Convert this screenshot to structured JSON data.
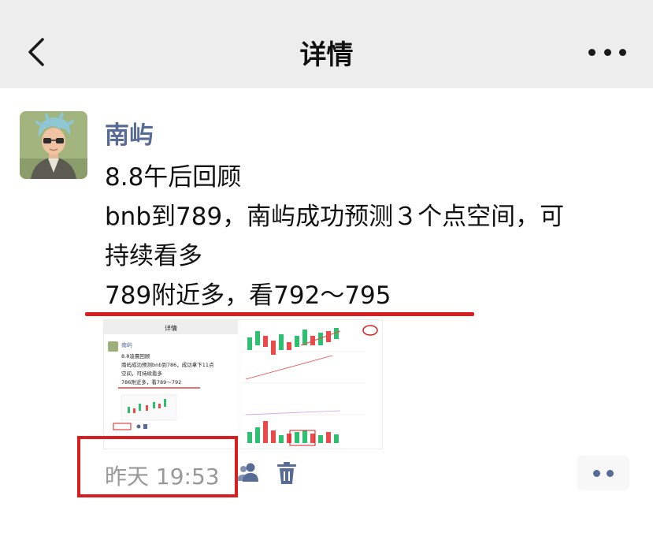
{
  "navbar": {
    "back_icon": "chevron-left-icon",
    "title": "详情",
    "more_icon": "ellipsis-icon"
  },
  "post": {
    "author": "南屿",
    "lines": [
      "8.8午后回顾",
      "bnb到789，南屿成功预测３个点空间，可",
      "持续看多",
      "789附近多，看792～795"
    ],
    "image": {
      "inner_title": "详情",
      "inner_author": "南屿",
      "inner_lines": [
        "8.8凌晨回顾",
        "南屿成功预测bnb到786，成功拿下11点",
        "空间，可持续看多",
        "786附近多，看789～792"
      ]
    },
    "timestamp": "昨天 19:53",
    "highlight_color": "#d81e1e",
    "name_color": "#576b95"
  },
  "actions": {
    "visibility_icon": "friends-icon",
    "delete_icon": "trash-icon",
    "comment_icon": "comment-dots-icon"
  }
}
